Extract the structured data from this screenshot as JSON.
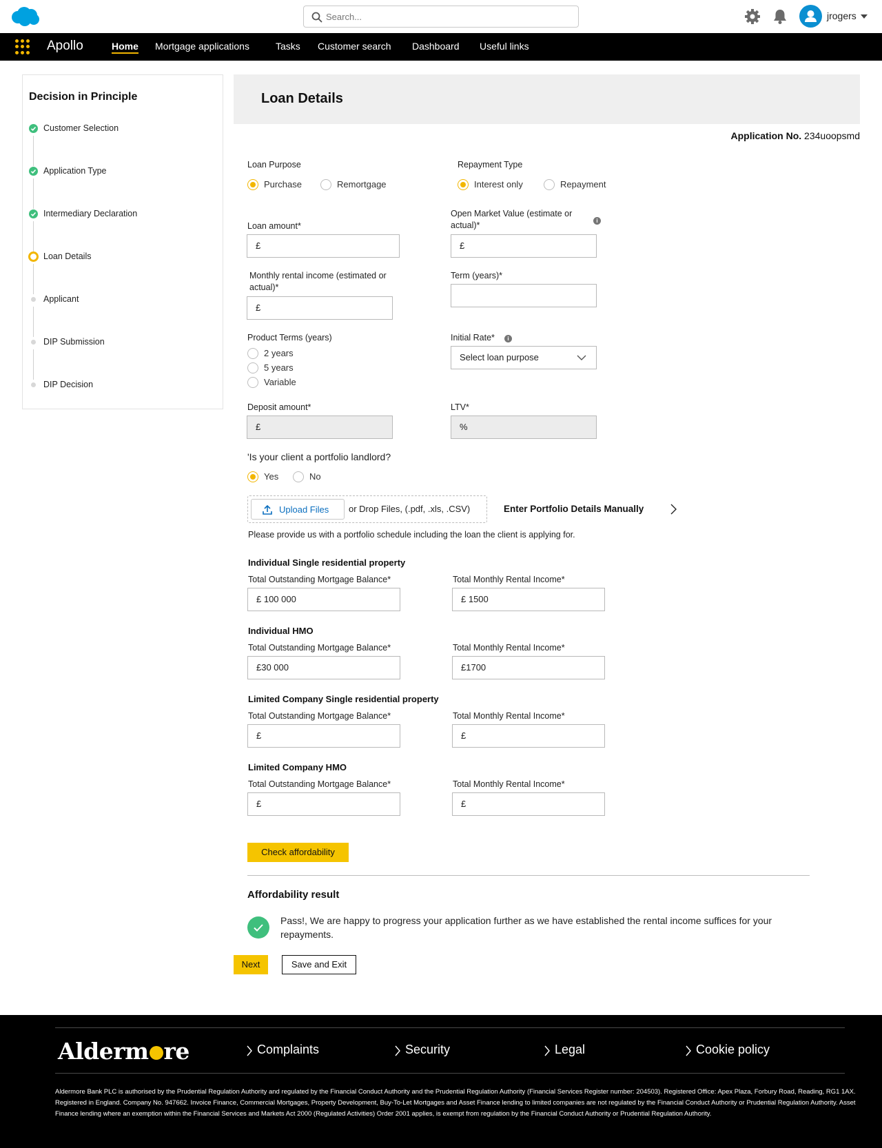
{
  "header": {
    "search_placeholder": "Search...",
    "username": "jrogers",
    "brand_color": "#00a1e0"
  },
  "nav": {
    "app_name": "Apollo",
    "items": [
      "Home",
      "Mortgage applications",
      "Tasks",
      "Customer search",
      "Dashboard",
      "Useful links"
    ],
    "active": "Home"
  },
  "progress": {
    "title": "Decision in Principle",
    "steps": [
      {
        "label": "Customer Selection",
        "status": "done"
      },
      {
        "label": "Application Type",
        "status": "done"
      },
      {
        "label": "Intermediary Declaration",
        "status": "done"
      },
      {
        "label": "Loan Details",
        "status": "current"
      },
      {
        "label": "Applicant",
        "status": "pending"
      },
      {
        "label": "DIP Submission",
        "status": "pending"
      },
      {
        "label": "DIP Decision",
        "status": "pending"
      }
    ]
  },
  "page": {
    "title": "Loan Details",
    "application_no_label": "Application No.",
    "application_no": "234uoopsmd"
  },
  "form": {
    "loan_purpose": {
      "label": "Loan Purpose",
      "options": [
        "Purchase",
        "Remortgage"
      ],
      "selected": "Purchase"
    },
    "repayment_type": {
      "label": "Repayment Type",
      "options": [
        "Interest only",
        "Repayment"
      ],
      "selected": "Interest only"
    },
    "loan_amount": {
      "label": "Loan amount*",
      "value": "£"
    },
    "open_market_value": {
      "label": "Open Market  Value (estimate or actual)*",
      "value": "£"
    },
    "monthly_rental": {
      "label": "Monthly rental income (estimated or actual)*",
      "value": "£"
    },
    "term": {
      "label": "Term (years)*",
      "value": ""
    },
    "product_terms": {
      "label": "Product Terms (years)",
      "options": [
        "2 years",
        "5 years",
        "Variable"
      ],
      "selected": ""
    },
    "initial_rate": {
      "label": "Initial Rate*",
      "value": "Select loan purpose"
    },
    "deposit": {
      "label": "Deposit amount*",
      "value": "£"
    },
    "ltv": {
      "label": "LTV*",
      "value": "%"
    },
    "portfolio_question": {
      "label": "'Is your client a portfolio landlord?",
      "options": [
        "Yes",
        "No"
      ],
      "selected": "Yes"
    },
    "upload": {
      "button": "Upload Files",
      "drop_text": "or Drop Files, (.pdf, .xls, .CSV)",
      "manual_link": "Enter Portfolio Details Manually",
      "hint": "Please provide us with a portfolio schedule including the loan the client is applying for."
    },
    "portfolio_sections": [
      {
        "title": "Individual Single residential property",
        "balance_label": "Total Outstanding Mortgage Balance*",
        "balance": "£ 100 000",
        "income_label": "Total Monthly Rental Income*",
        "income": "£ 1500"
      },
      {
        "title": "Individual HMO",
        "balance_label": "Total Outstanding Mortgage Balance*",
        "balance": "£30 000",
        "income_label": "Total Monthly Rental Income*",
        "income": "£1700"
      },
      {
        "title": "Limited Company Single residential property",
        "balance_label": "Total Outstanding Mortgage Balance*",
        "balance": "£",
        "income_label": "Total Monthly Rental Income*",
        "income": "£"
      },
      {
        "title": "Limited Company HMO",
        "balance_label": "Total Outstanding Mortgage Balance*",
        "balance": "£",
        "income_label": "Total Monthly Rental Income*",
        "income": "£"
      }
    ],
    "check_button": "Check affordability",
    "result_title": "Affordability result",
    "result_text": "Pass!, We are happy to progress your application further as we have established the rental income suffices for your repayments.",
    "next_button": "Next",
    "save_button": "Save and Exit"
  },
  "footer": {
    "logo_text": "Aldermore",
    "links": [
      "Complaints",
      "Security",
      "Legal",
      "Cookie policy"
    ],
    "legal_text": "Aldermore Bank PLC is authorised by the Prudential Regulation Authority and regulated by the Financial Conduct Authority and the Prudential Regulation Authority (Financial Services Register number: 204503). Registered Office: Apex Plaza, Forbury Road, Reading, RG1 1AX. Registered in England. Company No. 947662. Invoice Finance, Commercial Mortgages, Property Development, Buy-To-Let Mortgages and Asset Finance lending to limited companies are not regulated by the Financial Conduct Authority or Prudential Regulation Authority. Asset Finance lending where an exemption within the Financial Services and Markets Act 2000 (Regulated Activities) Order 2001 applies, is exempt from regulation by the Financial Conduct Authority or Prudential Regulation Authority."
  },
  "colors": {
    "accent": "#f5c400",
    "success": "#3fbf7d",
    "link": "#0b6fbf",
    "nav_bg": "#000000"
  }
}
